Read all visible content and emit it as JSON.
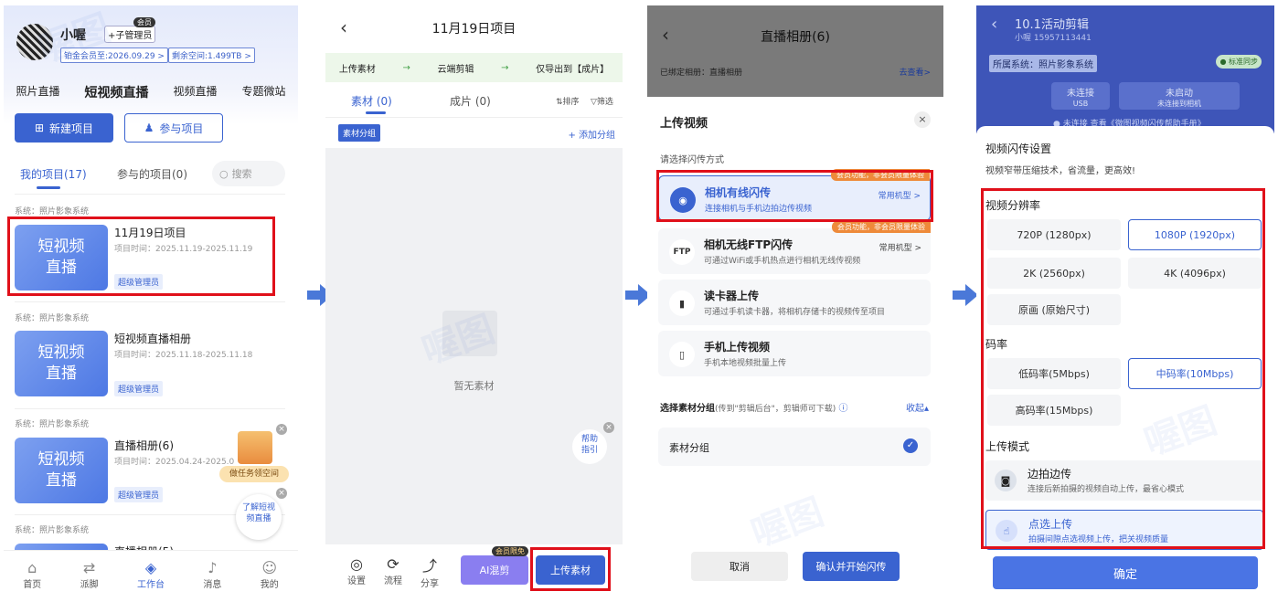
{
  "colors": {
    "accent": "#3a63d0",
    "red_highlight": "#e0101a",
    "flow_green": "#43a047",
    "tag_orange": "#ee8a3a"
  },
  "panel1": {
    "username": "小喔",
    "user_role": "+子管理员",
    "vip_label": "会员",
    "member_tag": "铂金会员至:2026.09.29 >",
    "space_tag": "剩余空间:1.499TB >",
    "nav_tabs": [
      "照片直播",
      "短视频直播",
      "视频直播",
      "专题微站"
    ],
    "new_project": "新建项目",
    "join_project": "参与项目",
    "my_projects": "我的项目(17)",
    "joined_projects": "参与的项目(0)",
    "search_placeholder": "搜索",
    "projects": [
      {
        "system": "系统：照片影象系统",
        "cover": "短视频\n直播",
        "title": "11月19日项目",
        "time": "项目时间：2025.11.19-2025.11.19",
        "role": "超级管理员"
      },
      {
        "system": "系统：照片影象系统",
        "cover": "短视频\n直播",
        "title": "短视频直播相册",
        "time": "项目时间：2025.11.18-2025.11.18",
        "role": "超级管理员"
      },
      {
        "system": "系统：照片影象系统",
        "cover": "短视频\n直播",
        "title": "直播相册(6)",
        "time": "项目时间：2025.04.24-2025.0",
        "role": "超级管理员"
      },
      {
        "system": "系统：照片影象系统",
        "cover": "",
        "title": "直播相册(5)",
        "time": "",
        "role": ""
      }
    ],
    "gift_label": "做任务领空间",
    "help_label": "了解短视\n频直播",
    "bottom_nav": [
      {
        "label": "首页",
        "icon": "home-icon",
        "glyph": "⌂"
      },
      {
        "label": "派脚",
        "icon": "dispatch-icon",
        "glyph": "⇄"
      },
      {
        "label": "工作台",
        "icon": "workbench-icon",
        "glyph": "◈"
      },
      {
        "label": "消息",
        "icon": "bell-icon",
        "glyph": "♪"
      },
      {
        "label": "我的",
        "icon": "user-icon",
        "glyph": "☺"
      }
    ]
  },
  "panel2": {
    "title": "11月19日项目",
    "back_glyph": "‹",
    "flow": [
      "上传素材",
      "→",
      "云端剪辑",
      "→",
      "仅导出到【成片】"
    ],
    "tab_material": "素材 (0)",
    "tab_finished": "成片 (0)",
    "sort": "排序",
    "filter": "筛选",
    "group_button": "素材分组",
    "add_group": "+ 添加分组",
    "empty_text": "暂无素材",
    "help_guide": "帮助\n指引",
    "tools": [
      {
        "label": "设置",
        "glyph": "◎"
      },
      {
        "label": "流程",
        "glyph": "⟳"
      },
      {
        "label": "分享",
        "glyph": "⤴"
      }
    ],
    "ai_cut": "AI混剪",
    "ai_badge": "会员限免",
    "upload": "上传素材"
  },
  "panel3": {
    "album_title": "直播相册(6)",
    "bound_label": "已绑定相册：直播相册",
    "go_view": "去查看>",
    "sheet_title": "上传视频",
    "choose_method": "请选择闪传方式",
    "options": [
      {
        "title": "相机有线闪传",
        "desc": "连接相机与手机边拍边传视频",
        "tag": "会员功能，非会员限量体验",
        "right": "常用机型 >",
        "icon": "camera-icon",
        "glyph": "◉"
      },
      {
        "title": "相机无线FTP闪传",
        "desc": "可通过WiFi或手机热点进行相机无线传视频",
        "tag": "会员功能，非会员限量体验",
        "right": "常用机型 >",
        "icon": "ftp-icon",
        "glyph": "FTP"
      },
      {
        "title": "读卡器上传",
        "desc": "可通过手机读卡器，将相机存储卡的视频传至项目",
        "tag": "",
        "right": "",
        "icon": "card-reader-icon",
        "glyph": "▮"
      },
      {
        "title": "手机上传视频",
        "desc": "手机本地视频批量上传",
        "tag": "",
        "right": "",
        "icon": "phone-upload-icon",
        "glyph": "▯"
      }
    ],
    "select_group": "选择素材分组",
    "select_group_hint": "(传到\"剪辑后台\"，剪辑师可下载)",
    "collapse": "收起▴",
    "group_name": "素材分组",
    "cancel": "取消",
    "confirm": "确认并开始闪传"
  },
  "panel4": {
    "project_title": "10.1活动剪辑",
    "project_sub": "小喔 15957113441",
    "system_label": "所属系统：照片影象系统",
    "sync_badge": "● 标准同步",
    "status1": "未连接",
    "status1_sub": "USB",
    "status2": "未启动",
    "status2_sub": "未连接到相机",
    "help_line": "● 未连接  查看《微图视频闪传帮助手册》",
    "sheet_title": "视频闪传设置",
    "sheet_sub": "视频窄带压缩技术，省流量，更高效!",
    "resolution_label": "视频分辨率",
    "resolutions": [
      {
        "label": "720P (1280px)",
        "selected": false
      },
      {
        "label": "1080P (1920px)",
        "selected": true
      },
      {
        "label": "2K (2560px)",
        "selected": false
      },
      {
        "label": "4K (4096px)",
        "selected": false
      },
      {
        "label": "原画 (原始尺寸)",
        "selected": false
      }
    ],
    "bitrate_label": "码率",
    "bitrates": [
      {
        "label": "低码率(5Mbps)",
        "selected": false
      },
      {
        "label": "中码率(10Mbps)",
        "selected": true
      },
      {
        "label": "高码率(15Mbps)",
        "selected": false
      }
    ],
    "mode_label": "上传模式",
    "modes": [
      {
        "title": "边拍边传",
        "desc": "连接后新拍摄的视频自动上传，最省心模式",
        "selected": false,
        "icon": "camera-small-icon",
        "glyph": "◙"
      },
      {
        "title": "点选上传",
        "desc": "拍摄间隙点选视频上传，把关视频质量",
        "selected": true,
        "icon": "hand-select-icon",
        "glyph": "☝"
      }
    ],
    "ok": "确定"
  },
  "watermark": "喔图"
}
